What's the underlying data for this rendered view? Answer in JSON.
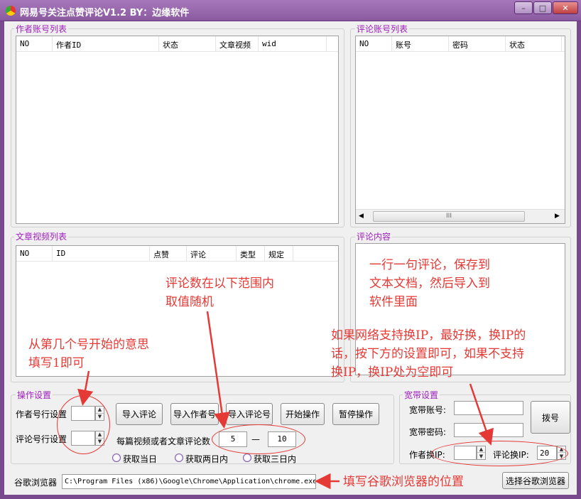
{
  "window": {
    "title": "网易号关注点赞评论V1.2 BY：边缘软件",
    "min": "–",
    "max": "□",
    "close": "✕"
  },
  "author_list": {
    "label": "作者账号列表",
    "columns": [
      "NO",
      "作者ID",
      "状态",
      "文章视频",
      "wid"
    ]
  },
  "comment_accounts": {
    "label": "评论账号列表",
    "columns": [
      "NO",
      "账号",
      "密码",
      "状态"
    ],
    "scroll_thumb": "III"
  },
  "article_list": {
    "label": "文章视频列表",
    "columns": [
      "NO",
      "ID",
      "点赞",
      "评论",
      "类型",
      "规定"
    ]
  },
  "comment_content": {
    "label": "评论内容"
  },
  "ops": {
    "label": "操作设置",
    "author_row_label": "作者号行设置",
    "comment_row_label": "评论号行设置",
    "author_row_value": "",
    "comment_row_value": "",
    "buttons": {
      "import_comment": "导入评论",
      "import_author": "导入作者号",
      "import_comment_acc": "导入评论号",
      "start": "开始操作",
      "pause": "暂停操作"
    },
    "per_label": "每篇视频或者文章评论数",
    "min": "5",
    "dash": "—",
    "max": "10",
    "radios": [
      "获取当日",
      "获取两日内",
      "获取三日内"
    ]
  },
  "broadband": {
    "label": "宽带设置",
    "account_label": "宽带账号:",
    "password_label": "宽带密码:",
    "account_value": "",
    "password_value": "",
    "dial": "拨号",
    "author_ip_label": "作者换IP:",
    "comment_ip_label": "评论换IP:",
    "author_ip_value": "",
    "comment_ip_value": "20"
  },
  "chrome": {
    "label": "谷歌浏览器",
    "path": "C:\\Program Files (x86)\\Google\\Chrome\\Application\\chrome.exe",
    "select": "选择谷歌浏览器"
  },
  "annotations": {
    "comment_hint": [
      "一行一句评论，保存到",
      "文本文档，然后导入到",
      "软件里面"
    ],
    "range_hint": [
      "评论数在以下范围内",
      "取值随机"
    ],
    "start_hint": [
      "从第几个号开始的意思",
      "填写1即可"
    ],
    "ip_hint": [
      "如果网络支持换IP，最好换，换IP的",
      "话，按下方的设置即可，如果不支持",
      "换IP，换IP处为空即可"
    ],
    "chrome_hint": "填写谷歌浏览器的位置"
  },
  "colors": {
    "frame": "#7a4a8e",
    "group_label": "#a020c0",
    "annotation": "#e53935"
  }
}
